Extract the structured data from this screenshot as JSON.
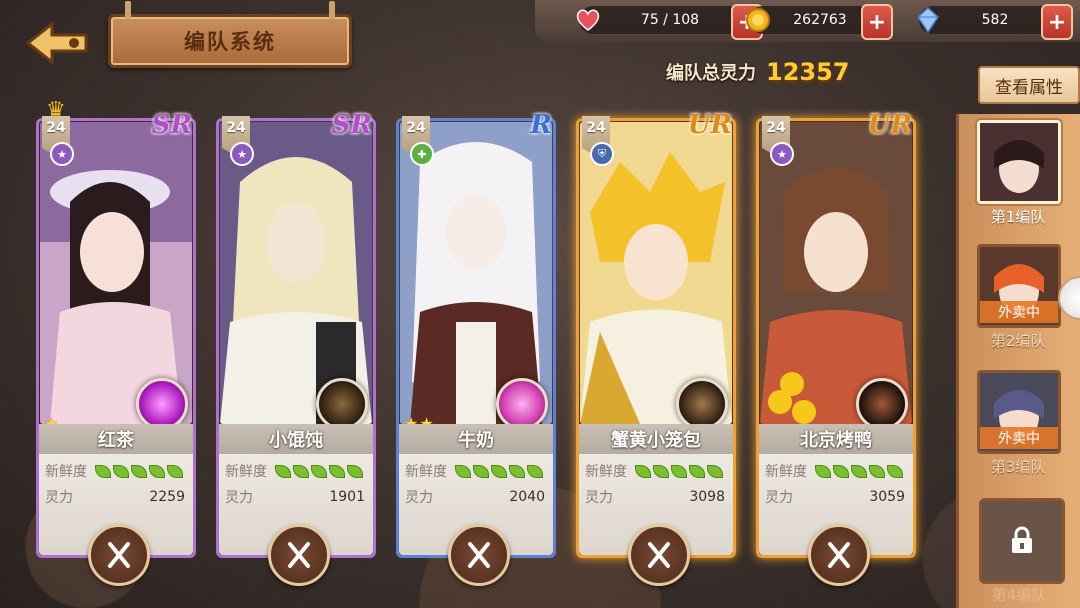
{
  "header": {
    "title": "编队系统"
  },
  "resources": [
    {
      "name": "stamina",
      "icon": "heart-icon",
      "value": "75 / 108",
      "color": "#e8505b"
    },
    {
      "name": "gold",
      "icon": "coin-icon",
      "value": "262763",
      "color": "#f5b21e"
    },
    {
      "name": "diamond",
      "icon": "crystal-icon",
      "value": "582",
      "color": "#7fb4ff"
    }
  ],
  "team_power": {
    "label": "编队总灵力",
    "value": "12357"
  },
  "buttons": {
    "view_attributes": "查看属性"
  },
  "cards": [
    {
      "name": "红茶",
      "level": "24",
      "rarity": "SR",
      "rarity_color": "#b04dc7",
      "frame_color": "#b070d0",
      "stars": 1,
      "freshness_label": "新鲜度",
      "freshness": 5,
      "power_label": "灵力",
      "power": "2259",
      "leader": true
    },
    {
      "name": "小馄饨",
      "level": "24",
      "rarity": "SR",
      "rarity_color": "#b04dc7",
      "frame_color": "#b070d0",
      "stars": 0,
      "freshness_label": "新鲜度",
      "freshness": 5,
      "power_label": "灵力",
      "power": "1901",
      "leader": false
    },
    {
      "name": "牛奶",
      "level": "24",
      "rarity": "R",
      "rarity_color": "#3a6ed8",
      "frame_color": "#5a82d8",
      "stars": 2,
      "freshness_label": "新鲜度",
      "freshness": 5,
      "power_label": "灵力",
      "power": "2040",
      "leader": false
    },
    {
      "name": "蟹黄小笼包",
      "level": "24",
      "rarity": "UR",
      "rarity_color": "#e08a10",
      "frame_color": "#f0a030",
      "stars": 0,
      "freshness_label": "新鲜度",
      "freshness": 5,
      "power_label": "灵力",
      "power": "3098",
      "leader": false
    },
    {
      "name": "北京烤鸭",
      "level": "24",
      "rarity": "UR",
      "rarity_color": "#e08a10",
      "frame_color": "#f0a030",
      "stars": 0,
      "freshness_label": "新鲜度",
      "freshness": 5,
      "power_label": "灵力",
      "power": "3059",
      "leader": false
    }
  ],
  "teams": [
    {
      "label": "第1编队",
      "status": ""
    },
    {
      "label": "第2编队",
      "status": "外卖中"
    },
    {
      "label": "第3编队",
      "status": "外卖中"
    },
    {
      "label": "第4编队",
      "status": ""
    }
  ]
}
